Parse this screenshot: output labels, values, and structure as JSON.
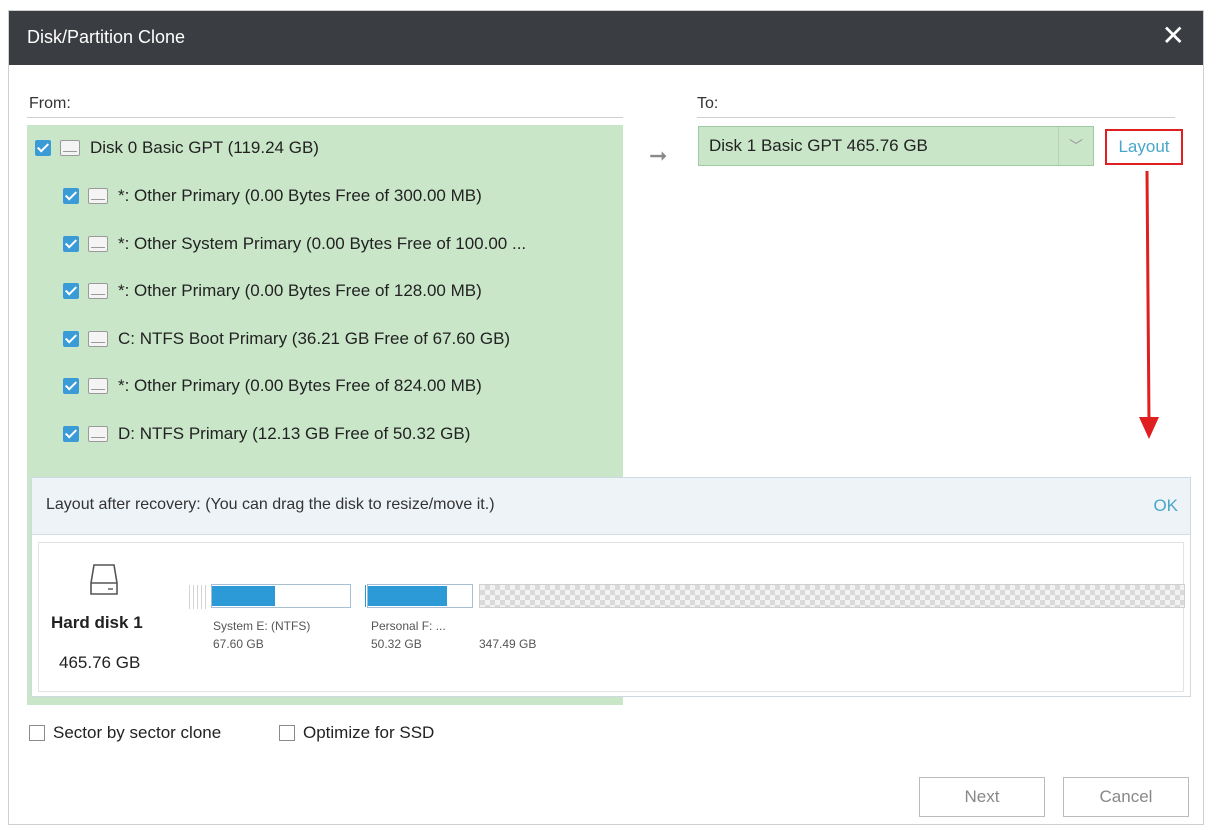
{
  "window": {
    "title": "Disk/Partition Clone",
    "close_glyph": "✕"
  },
  "from": {
    "label": "From:",
    "disk": {
      "label": "Disk 0 Basic GPT (119.24 GB)",
      "checked": true
    },
    "partitions": [
      {
        "label": "*: Other Primary  (0.00 Bytes Free of 300.00 MB)",
        "checked": true
      },
      {
        "label": "*: Other System Primary  (0.00 Bytes Free of 100.00 ...",
        "checked": true
      },
      {
        "label": "*: Other Primary  (0.00 Bytes Free of 128.00 MB)",
        "checked": true
      },
      {
        "label": "C: NTFS Boot Primary  (36.21 GB Free of 67.60 GB)",
        "checked": true
      },
      {
        "label": "*: Other Primary  (0.00 Bytes Free of 824.00 MB)",
        "checked": true
      },
      {
        "label": "D: NTFS Primary  (12.13 GB Free of 50.32 GB)",
        "checked": true
      }
    ]
  },
  "to": {
    "label": "To:",
    "selected": "Disk 1 Basic GPT 465.76 GB",
    "layout_link": "Layout"
  },
  "layout_panel": {
    "title": "Layout after recovery: (You can drag the disk to resize/move it.)",
    "ok": "OK",
    "disk_name": "Hard disk 1",
    "disk_size": "465.76 GB",
    "partitions": [
      {
        "name": "System E: (NTFS)",
        "size": "67.60 GB",
        "used_fraction": 0.46
      },
      {
        "name": "Personal F: ...",
        "size": "50.32 GB",
        "used_fraction": 0.76
      },
      {
        "name": "",
        "size": "347.49 GB",
        "unallocated": true
      }
    ]
  },
  "options": {
    "sector_by_sector": "Sector by sector clone",
    "optimize_ssd": "Optimize for SSD"
  },
  "buttons": {
    "next": "Next",
    "cancel": "Cancel"
  },
  "colors": {
    "titlebar": "#3a3d42",
    "selection": "#c9e6c9",
    "accent": "#2d9ad8",
    "link": "#4aa6c8",
    "highlight": "#e02020"
  }
}
